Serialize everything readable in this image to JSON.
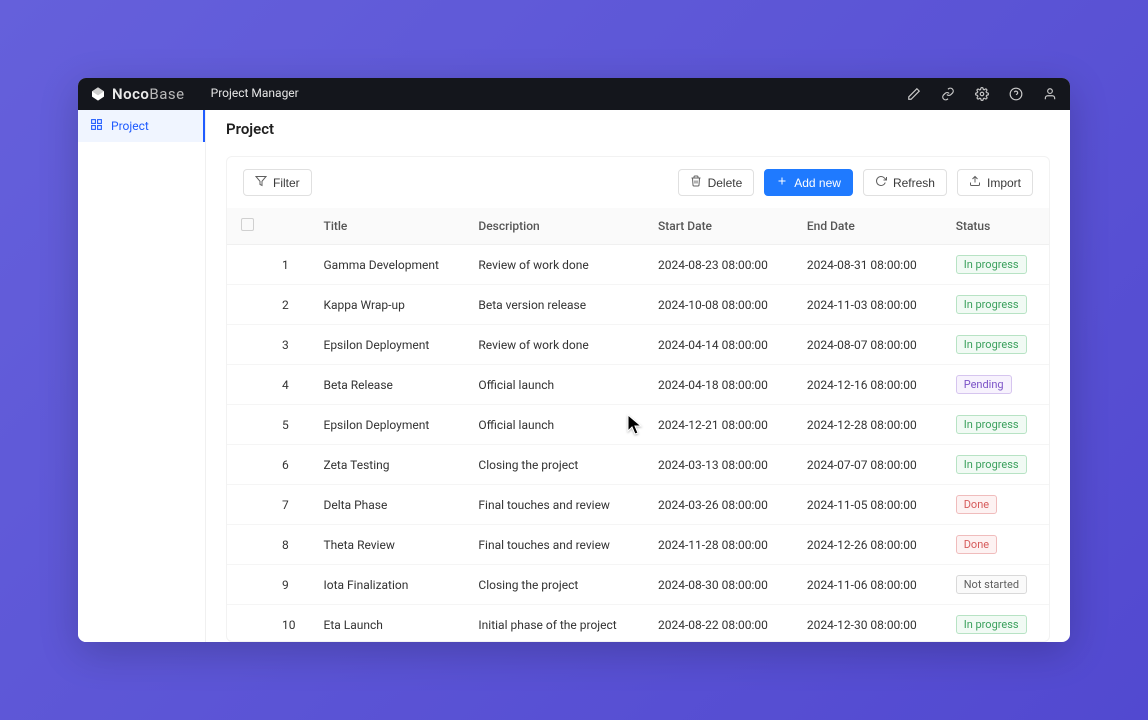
{
  "brand": {
    "name1": "Noco",
    "name2": "Base"
  },
  "tab": {
    "label": "Project Manager"
  },
  "sidebar": {
    "items": [
      {
        "label": "Project"
      }
    ]
  },
  "page": {
    "title": "Project"
  },
  "toolbar": {
    "filter": "Filter",
    "delete": "Delete",
    "addnew": "Add new",
    "refresh": "Refresh",
    "import": "Import"
  },
  "table": {
    "headers": {
      "title": "Title",
      "description": "Description",
      "start": "Start Date",
      "end": "End Date",
      "status": "Status"
    },
    "rows": [
      {
        "n": "1",
        "title": "Gamma Development",
        "desc": "Review of work done",
        "start": "2024-08-23 08:00:00",
        "end": "2024-08-31 08:00:00",
        "status": "In progress",
        "statusKind": "in-progress"
      },
      {
        "n": "2",
        "title": "Kappa Wrap-up",
        "desc": "Beta version release",
        "start": "2024-10-08 08:00:00",
        "end": "2024-11-03 08:00:00",
        "status": "In progress",
        "statusKind": "in-progress"
      },
      {
        "n": "3",
        "title": "Epsilon Deployment",
        "desc": "Review of work done",
        "start": "2024-04-14 08:00:00",
        "end": "2024-08-07 08:00:00",
        "status": "In progress",
        "statusKind": "in-progress"
      },
      {
        "n": "4",
        "title": "Beta Release",
        "desc": "Official launch",
        "start": "2024-04-18 08:00:00",
        "end": "2024-12-16 08:00:00",
        "status": "Pending",
        "statusKind": "pending"
      },
      {
        "n": "5",
        "title": "Epsilon Deployment",
        "desc": "Official launch",
        "start": "2024-12-21 08:00:00",
        "end": "2024-12-28 08:00:00",
        "status": "In progress",
        "statusKind": "in-progress"
      },
      {
        "n": "6",
        "title": "Zeta Testing",
        "desc": "Closing the project",
        "start": "2024-03-13 08:00:00",
        "end": "2024-07-07 08:00:00",
        "status": "In progress",
        "statusKind": "in-progress"
      },
      {
        "n": "7",
        "title": "Delta Phase",
        "desc": "Final touches and review",
        "start": "2024-03-26 08:00:00",
        "end": "2024-11-05 08:00:00",
        "status": "Done",
        "statusKind": "done"
      },
      {
        "n": "8",
        "title": "Theta Review",
        "desc": "Final touches and review",
        "start": "2024-11-28 08:00:00",
        "end": "2024-12-26 08:00:00",
        "status": "Done",
        "statusKind": "done"
      },
      {
        "n": "9",
        "title": "Iota Finalization",
        "desc": "Closing the project",
        "start": "2024-08-30 08:00:00",
        "end": "2024-11-06 08:00:00",
        "status": "Not started",
        "statusKind": "not-started"
      },
      {
        "n": "10",
        "title": "Eta Launch",
        "desc": "Initial phase of the project",
        "start": "2024-08-22 08:00:00",
        "end": "2024-12-30 08:00:00",
        "status": "In progress",
        "statusKind": "in-progress"
      }
    ]
  }
}
